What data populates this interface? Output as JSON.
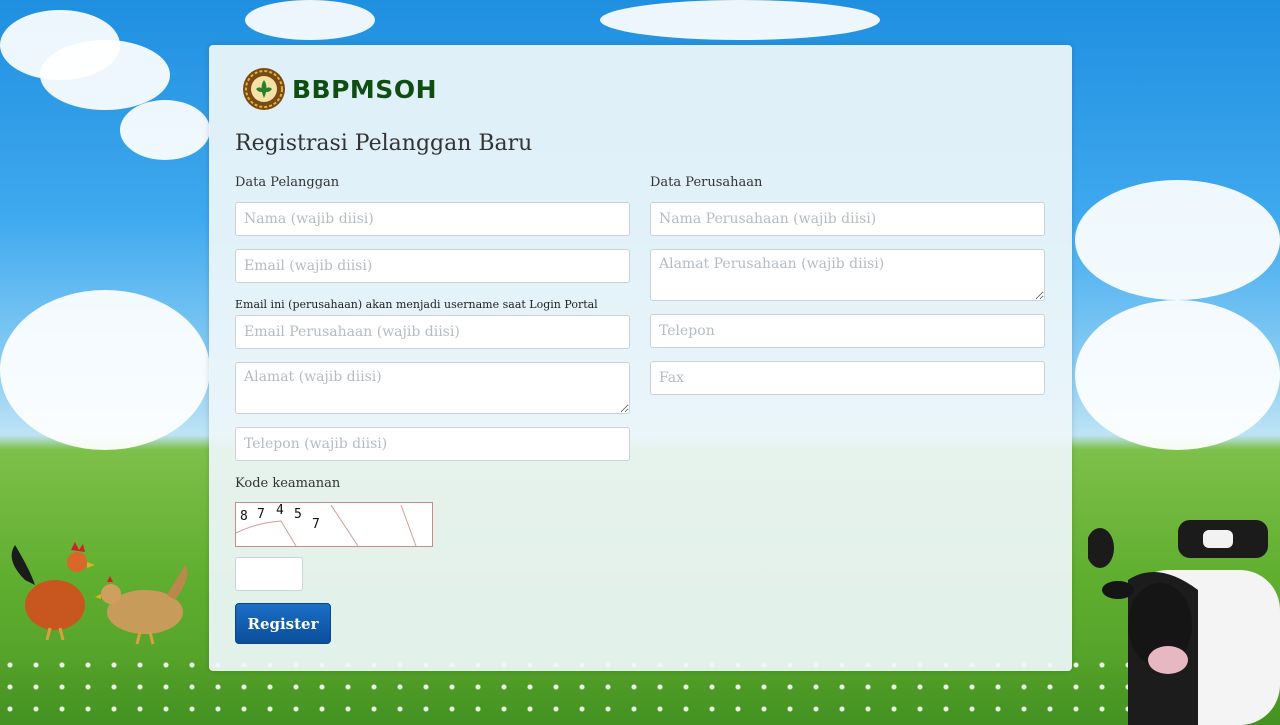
{
  "brand": {
    "name": "BBPMSOH"
  },
  "title": "Registrasi Pelanggan Baru",
  "customer_section": {
    "label": "Data Pelanggan",
    "name_placeholder": "Nama (wajib diisi)",
    "email_placeholder": "Email (wajib diisi)",
    "username_note": "Email ini (perusahaan) akan menjadi username saat Login Portal",
    "company_email_placeholder": "Email Perusahaan (wajib diisi)",
    "address_placeholder": "Alamat (wajib diisi)",
    "phone_placeholder": "Telepon (wajib diisi)"
  },
  "company_section": {
    "label": "Data Perusahaan",
    "company_name_placeholder": "Nama Perusahaan (wajib diisi)",
    "company_address_placeholder": "Alamat Perusahaan (wajib diisi)",
    "phone_placeholder": "Telepon",
    "fax_placeholder": "Fax"
  },
  "captcha": {
    "label": "Kode keamanan",
    "digits": [
      "8",
      "7",
      "4",
      "5",
      "7"
    ],
    "input_value": ""
  },
  "register_label": "Register",
  "colors": {
    "brand_green": "#0f4d12",
    "button_blue": "#0b5fae",
    "panel_bg": "#eef6fa"
  }
}
